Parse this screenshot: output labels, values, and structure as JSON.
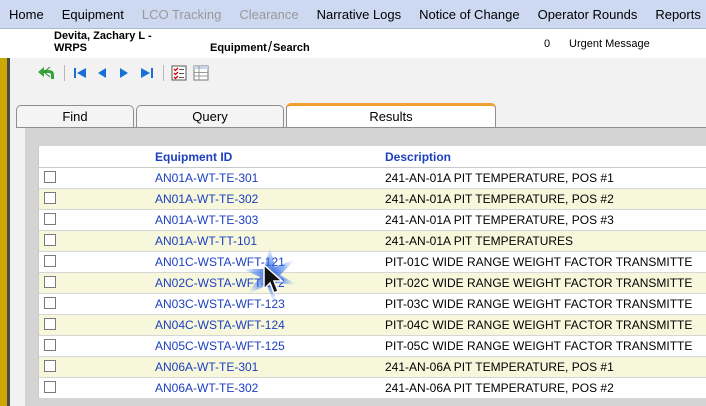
{
  "menu": {
    "items": [
      {
        "label": "Home",
        "disabled": false
      },
      {
        "label": "Equipment",
        "disabled": false
      },
      {
        "label": "LCO Tracking",
        "disabled": true
      },
      {
        "label": "Clearance",
        "disabled": true
      },
      {
        "label": "Narrative Logs",
        "disabled": false
      },
      {
        "label": "Notice of Change",
        "disabled": false
      },
      {
        "label": "Operator Rounds",
        "disabled": false
      },
      {
        "label": "Reports",
        "disabled": false
      }
    ]
  },
  "user_bar": {
    "user_name": "Devita, Zachary L - WRPS",
    "crumb_section": "Equipment",
    "crumb_slash": "/",
    "crumb_page": "Search",
    "urgent_count": "0",
    "urgent_label": "Urgent Message"
  },
  "toolbar": {
    "icons": [
      "back-arrow-icon",
      "first-record-icon",
      "previous-record-icon",
      "next-record-icon",
      "last-record-icon",
      "checklist-icon",
      "grid-view-icon"
    ]
  },
  "tabs": [
    {
      "label": "Find",
      "active": false
    },
    {
      "label": "Query",
      "active": false
    },
    {
      "label": "Results",
      "active": true
    }
  ],
  "results": {
    "columns": {
      "equipment_id": "Equipment ID",
      "description": "Description"
    },
    "rows": [
      {
        "id": "AN01A-WT-TE-301",
        "desc": "241-AN-01A PIT TEMPERATURE, POS #1"
      },
      {
        "id": "AN01A-WT-TE-302",
        "desc": "241-AN-01A PIT TEMPERATURE, POS #2"
      },
      {
        "id": "AN01A-WT-TE-303",
        "desc": "241-AN-01A PIT TEMPERATURE, POS #3"
      },
      {
        "id": "AN01A-WT-TT-101",
        "desc": "241-AN-01A PIT TEMPERATURES"
      },
      {
        "id": "AN01C-WSTA-WFT-121",
        "desc": "PIT-01C WIDE RANGE WEIGHT FACTOR TRANSMITTE"
      },
      {
        "id": "AN02C-WSTA-WFT-122",
        "desc": "PIT-02C WIDE RANGE WEIGHT FACTOR TRANSMITTE"
      },
      {
        "id": "AN03C-WSTA-WFT-123",
        "desc": "PIT-03C WIDE RANGE WEIGHT FACTOR TRANSMITTE"
      },
      {
        "id": "AN04C-WSTA-WFT-124",
        "desc": "PIT-04C WIDE RANGE WEIGHT FACTOR TRANSMITTE"
      },
      {
        "id": "AN05C-WSTA-WFT-125",
        "desc": "PIT-05C WIDE RANGE WEIGHT FACTOR TRANSMITTE"
      },
      {
        "id": "AN06A-WT-TE-301",
        "desc": "241-AN-06A PIT TEMPERATURE, POS #1"
      },
      {
        "id": "AN06A-WT-TE-302",
        "desc": "241-AN-06A PIT TEMPERATURE, POS #2"
      }
    ]
  },
  "colors": {
    "menu_bg": "#ccd9f0",
    "link_blue": "#1c3fbf",
    "alt_row": "#f7f7dc",
    "accent_stripe": "#cda800",
    "active_tab_accent": "#f0a030"
  }
}
